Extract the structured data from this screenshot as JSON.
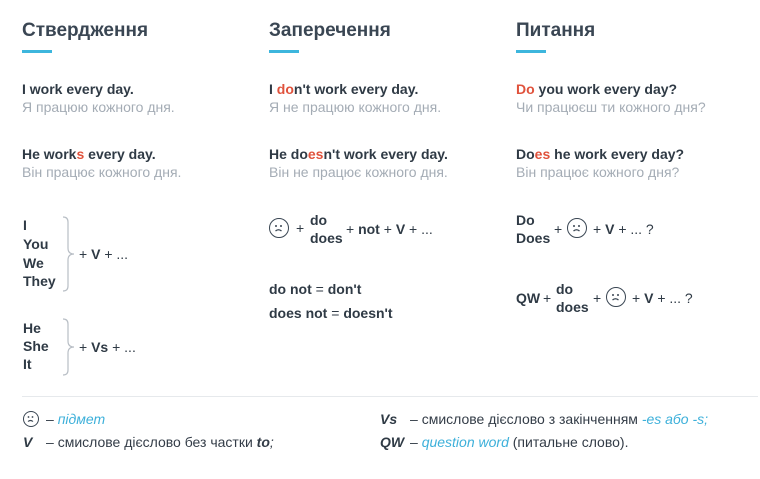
{
  "affirmative": {
    "title": "Ствердження",
    "ex1": {
      "en": "I work every day.",
      "ua": "Я працюю кожного дня."
    },
    "ex2": {
      "en_pre": "He work",
      "en_hl": "s",
      "en_post": " every day.",
      "ua": "Він працює кожного дня."
    },
    "group1": {
      "pronouns": [
        "I",
        "You",
        "We",
        "They"
      ],
      "plus": "+",
      "verb": "V",
      "tail": "+ ..."
    },
    "group2": {
      "pronouns": [
        "He",
        "She",
        "It"
      ],
      "plus": "+",
      "verb": "Vs",
      "tail": "+ ..."
    }
  },
  "negative": {
    "title": "Заперечення",
    "ex1": {
      "en_pre": "I ",
      "en_hl": "do",
      "en_post": "n't work every day.",
      "ua": "Я не працюю кожного дня."
    },
    "ex2": {
      "en_pre": "He do",
      "en_hl": "es",
      "en_post": "n't work every day.",
      "ua": "Він не працює кожного дня."
    },
    "formula": {
      "plus1": "+",
      "do": "do",
      "does": "does",
      "plus2": "+",
      "not": "not",
      "plus3": "+",
      "verb": "V",
      "tail": "+ ..."
    },
    "contr1": {
      "full": "do not",
      "eq": "=",
      "short": "don't"
    },
    "contr2": {
      "full": "does not",
      "eq": "=",
      "short": "doesn't"
    }
  },
  "question": {
    "title": "Питання",
    "ex1": {
      "en_hl": "Do",
      "en_post": " you work every day?",
      "ua": "Чи працюєш ти кожного дня?"
    },
    "ex2": {
      "en_pre": "Do",
      "en_hl": "es",
      "en_post": " he work every day?",
      "ua": "Він працює кожного дня?"
    },
    "formula1": {
      "do": "Do",
      "does": "Does",
      "plus1": "+",
      "plus2": "+",
      "verb": "V",
      "tail": "+ ... ?"
    },
    "formula2": {
      "qw": "QW",
      "plus1": "+",
      "do": "do",
      "does": "does",
      "plus2": "+",
      "plus3": "+",
      "verb": "V",
      "tail": "+ ... ?"
    }
  },
  "legend": {
    "subject": {
      "dash": "–",
      "text": "підмет"
    },
    "v": {
      "symbol": "V",
      "dash": "–",
      "text_pre": "смислове дієслово без частки ",
      "text_bold": "to",
      "text_post": ";"
    },
    "vs": {
      "symbol": "Vs",
      "dash": "–",
      "text_pre": "смислове дієслово з закінченням ",
      "text_blue": "-es або -s;"
    },
    "qw": {
      "symbol": "QW",
      "dash": "–",
      "text_blue": "question word",
      "text_post": " (питальне слово)."
    }
  },
  "colors": {
    "accent": "#3db6dd",
    "highlight": "#e0523c",
    "muted": "#a4acb5",
    "text": "#2f3a45"
  },
  "icons": {
    "subject": "worried-face-icon"
  }
}
